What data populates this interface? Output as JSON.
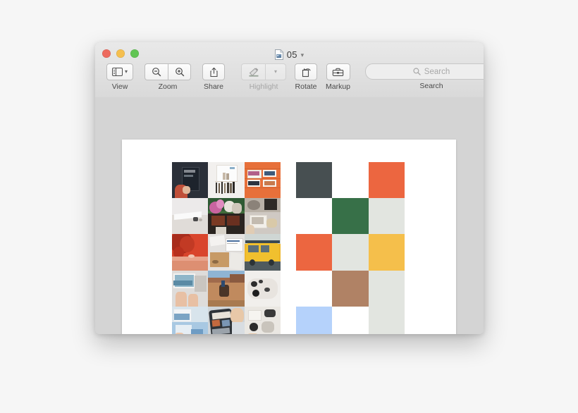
{
  "window": {
    "title": "05",
    "title_icon": "document-icon",
    "title_chevron": "chevron-down-icon",
    "traffic_lights": [
      {
        "name": "close",
        "color": "#ed6a5e"
      },
      {
        "name": "minimize",
        "color": "#f5bf4f"
      },
      {
        "name": "zoom",
        "color": "#61c554"
      }
    ]
  },
  "toolbar": {
    "view": {
      "label": "View",
      "icon": "sidebar-icon",
      "chevron": "chevron-down-icon"
    },
    "zoom": {
      "label": "Zoom",
      "out_icon": "zoom-out-icon",
      "in_icon": "zoom-in-icon"
    },
    "share": {
      "label": "Share",
      "icon": "share-icon"
    },
    "highlight": {
      "label": "Highlight",
      "icon": "highlighter-icon",
      "chevron": "chevron-down-icon",
      "disabled": true
    },
    "rotate": {
      "label": "Rotate",
      "icon": "rotate-left-icon"
    },
    "markup": {
      "label": "Markup",
      "icon": "toolbox-icon"
    },
    "search": {
      "label": "Search",
      "placeholder": "Search",
      "icon": "search-icon",
      "value": ""
    }
  },
  "document": {
    "photo_grid": {
      "rows": 5,
      "columns": 3,
      "tiles": [
        {
          "name": "hand-holding-tablet-dark",
          "bg": "#2b3039"
        },
        {
          "name": "cosmetics-shelf-white",
          "bg": "#f2f0ee"
        },
        {
          "name": "photo-wall-orange-brick",
          "bg": "#e7703a"
        },
        {
          "name": "white-table-minimal",
          "bg": "#eceaea"
        },
        {
          "name": "flowers-on-green-table",
          "bg": "#3f6b3b"
        },
        {
          "name": "desk-flatlay-grey",
          "bg": "#cfc9c3"
        },
        {
          "name": "red-tree-aerial",
          "bg": "#d9452c"
        },
        {
          "name": "documents-on-marble",
          "bg": "#dcdcdc"
        },
        {
          "name": "yellow-van",
          "bg": "#edb52a"
        },
        {
          "name": "hands-with-photos",
          "bg": "#d6d6d6"
        },
        {
          "name": "horse-rider-desert",
          "bg": "#b9784f"
        },
        {
          "name": "white-fur-accessories",
          "bg": "#efefef"
        },
        {
          "name": "hands-blue-prints",
          "bg": "#9fc0dd"
        },
        {
          "name": "tablet-browsing",
          "bg": "#5c6470"
        },
        {
          "name": "desk-accessories-flatlay",
          "bg": "#e3e0dc"
        }
      ]
    },
    "color_grid": {
      "rows": 5,
      "columns": 3,
      "swatches": [
        {
          "name": "dark-slate",
          "color": "#474f51"
        },
        {
          "name": "white",
          "color": "#ffffff"
        },
        {
          "name": "orange-red",
          "color": "#ec6640"
        },
        {
          "name": "white",
          "color": "#ffffff"
        },
        {
          "name": "forest-green",
          "color": "#377048"
        },
        {
          "name": "light-grey",
          "color": "#e2e5e0"
        },
        {
          "name": "orange-red",
          "color": "#ec6640"
        },
        {
          "name": "light-grey",
          "color": "#e2e5e0"
        },
        {
          "name": "golden-yellow",
          "color": "#f5bf4b"
        },
        {
          "name": "white",
          "color": "#ffffff"
        },
        {
          "name": "tan-brown",
          "color": "#b08265"
        },
        {
          "name": "light-grey",
          "color": "#e2e5e0"
        },
        {
          "name": "light-blue",
          "color": "#b5d2fb"
        },
        {
          "name": "white",
          "color": "#ffffff"
        },
        {
          "name": "light-grey",
          "color": "#e2e5e0"
        }
      ]
    }
  }
}
